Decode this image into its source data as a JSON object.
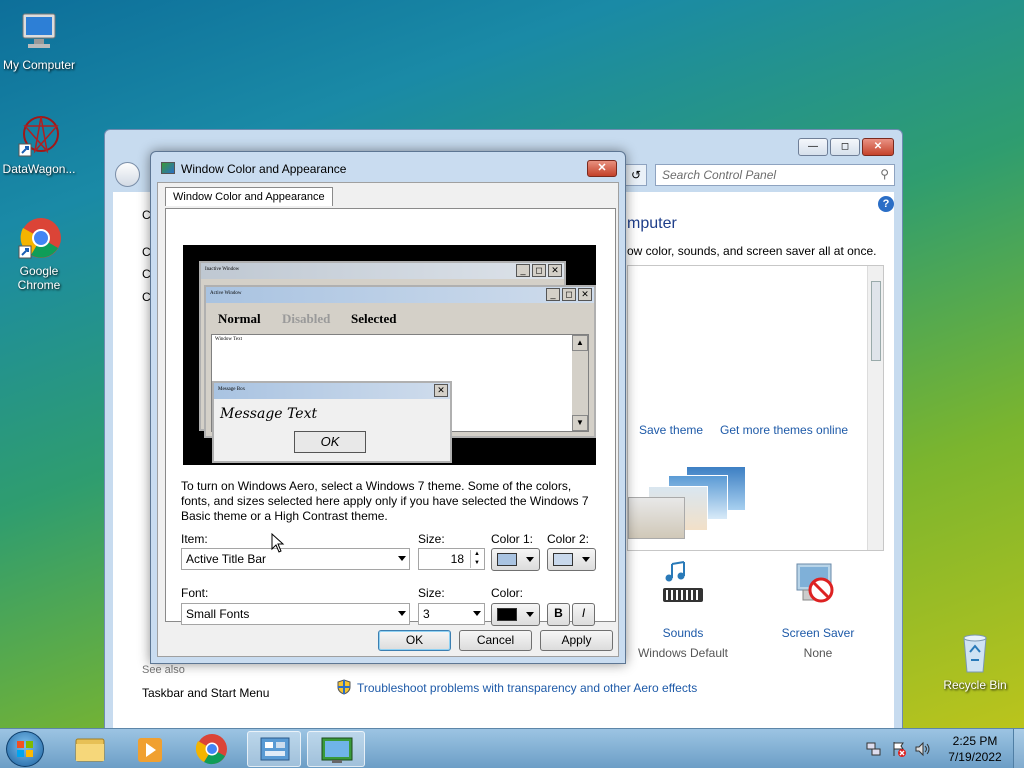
{
  "desktop": {
    "icons": [
      {
        "label": "My Computer"
      },
      {
        "label": "DataWagon..."
      },
      {
        "label": "Google Chrome"
      },
      {
        "label": "Recycle Bin"
      }
    ]
  },
  "control_panel": {
    "search_placeholder": "Search Control Panel",
    "heading_partial": "mputer",
    "subtext_partial": "ow color, sounds, and screen saver all at once.",
    "save_theme": "Save theme",
    "get_more_themes": "Get more themes online",
    "sounds_label": "Sounds",
    "sounds_value": "Windows Default",
    "screensaver_label": "Screen Saver",
    "screensaver_value": "None",
    "see_also": "See also",
    "taskbar_link": "Taskbar and Start Menu",
    "troubleshoot_link": "Troubleshoot problems with transparency and other Aero effects",
    "left_letters": [
      "C",
      "C",
      "C",
      "C"
    ]
  },
  "dialog": {
    "title": "Window Color and Appearance",
    "tab": "Window Color and Appearance",
    "preview": {
      "inactive_title": "Inactive Window",
      "active_title": "Active Window",
      "menu_normal": "Normal",
      "menu_disabled": "Disabled",
      "menu_selected": "Selected",
      "window_text": "Window Text",
      "msgbox_title": "Message Box",
      "message_text": "Message Text",
      "ok": "OK"
    },
    "info_text": "To turn on Windows Aero, select a Windows 7 theme.  Some of the colors, fonts, and sizes selected here apply only if you have selected the Windows 7 Basic theme or a High Contrast theme.",
    "item_label": "Item:",
    "item_value": "Active Title Bar",
    "size_label": "Size:",
    "size_value": "18",
    "color1_label": "Color 1:",
    "color2_label": "Color 2:",
    "color1": "#a9c3e1",
    "color2": "#c8d8ec",
    "font_label": "Font:",
    "font_value": "Small Fonts",
    "font_size_label": "Size:",
    "font_size_value": "3",
    "font_color_label": "Color:",
    "font_color": "#000000",
    "bold": "B",
    "italic": "I",
    "ok": "OK",
    "cancel": "Cancel",
    "apply": "Apply"
  },
  "taskbar": {
    "time": "2:25 PM",
    "date": "7/19/2022"
  }
}
